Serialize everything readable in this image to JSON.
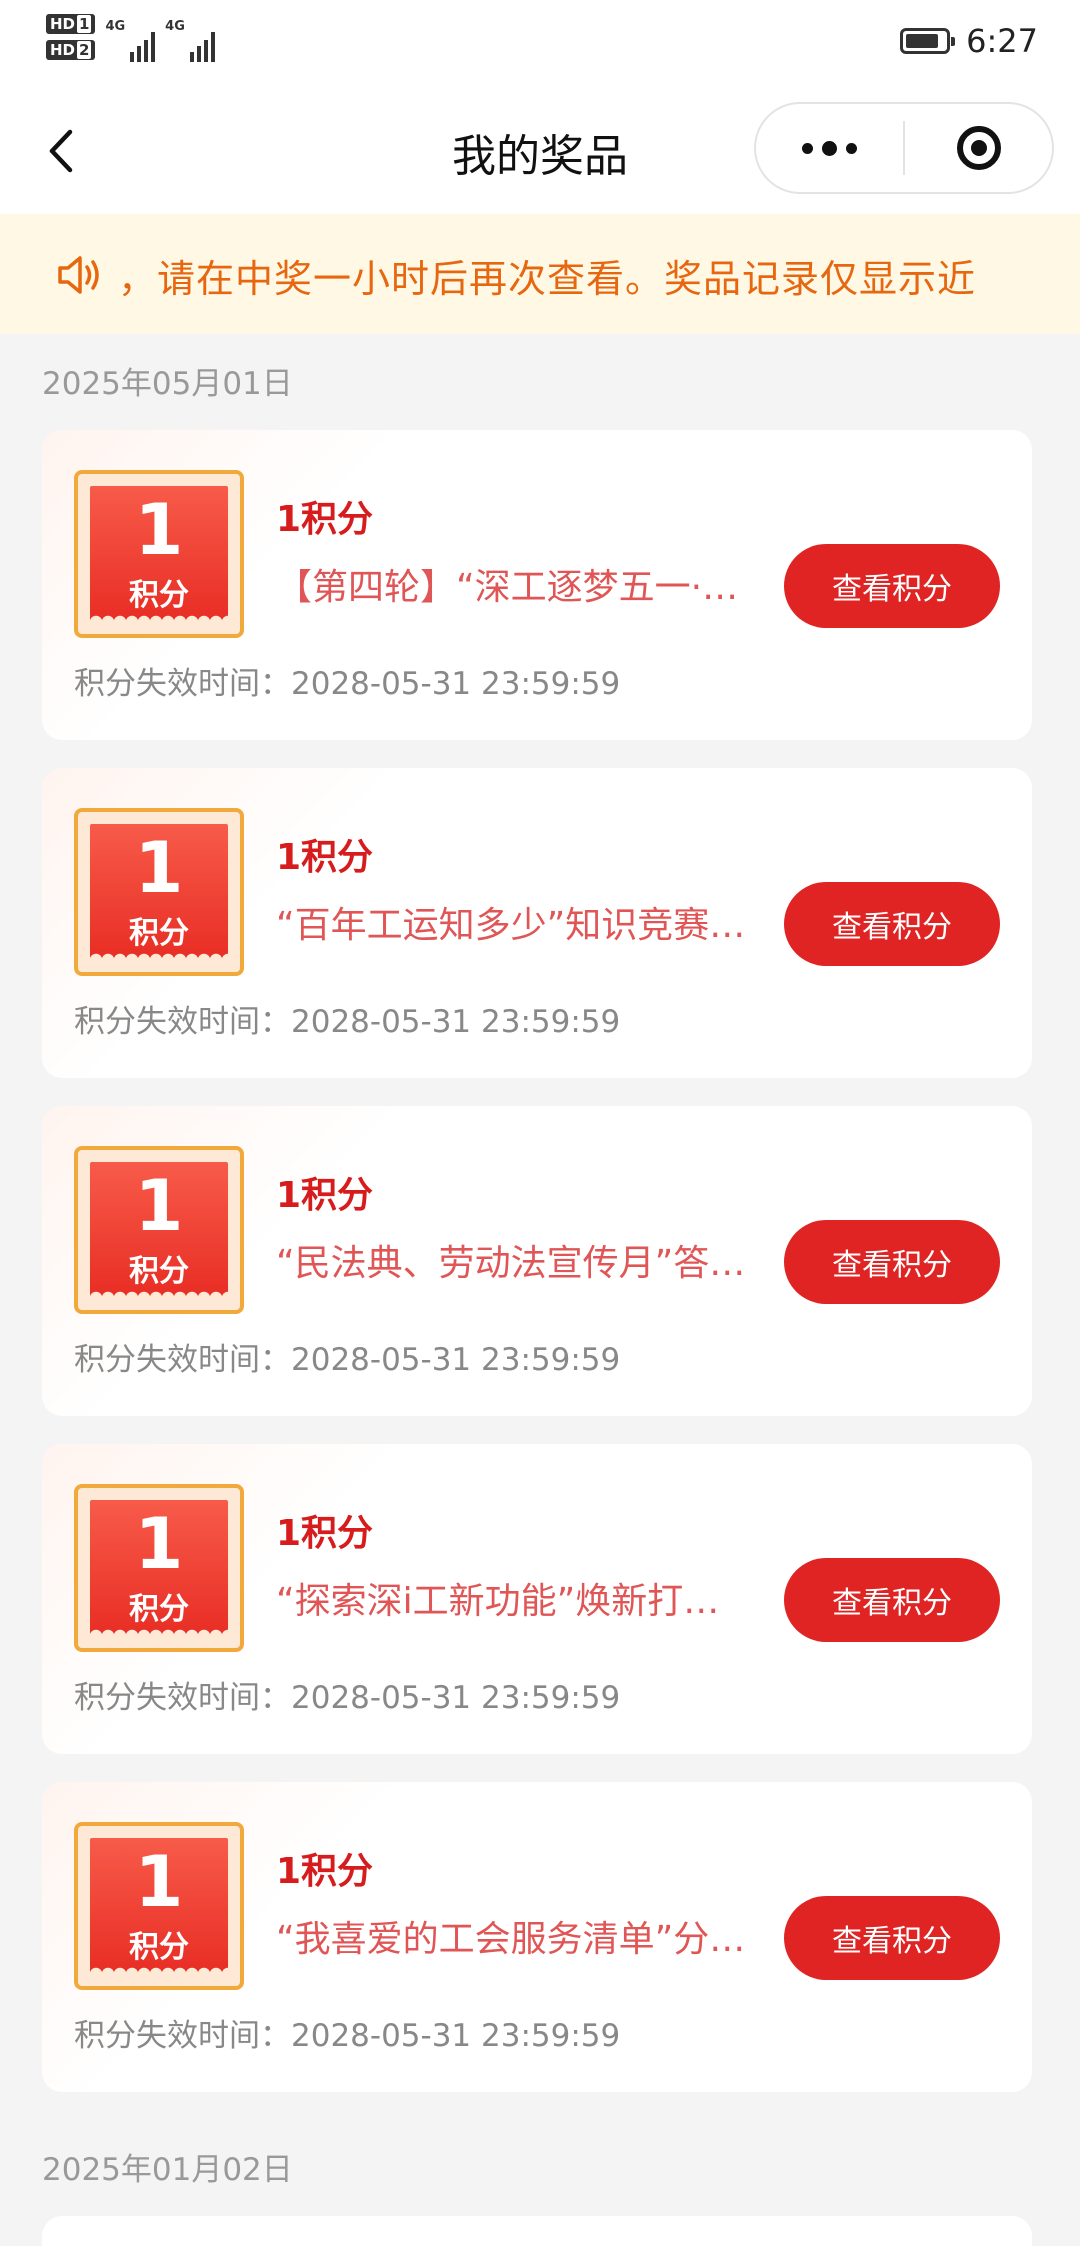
{
  "status_bar": {
    "sim1": "HD",
    "sim1_num": "1",
    "sim2": "HD",
    "sim2_num": "2",
    "net1": "4G",
    "net2": "4G",
    "time": "6:27",
    "battery_level": 0.85
  },
  "nav": {
    "title": "我的奖品"
  },
  "notice": {
    "text": "，请在中奖一小时后再次查看。奖品记录仅显示近"
  },
  "groups": [
    {
      "date": "2025年05月01日",
      "items": [
        {
          "badge_value": "1",
          "badge_unit": "积分",
          "name": "1积分",
          "desc": "【第四轮】“深工逐梦五一·…",
          "expire": "积分失效时间：2028-05-31 23:59:59",
          "button": "查看积分"
        },
        {
          "badge_value": "1",
          "badge_unit": "积分",
          "name": "1积分",
          "desc": "“百年工运知多少”知识竞赛…",
          "expire": "积分失效时间：2028-05-31 23:59:59",
          "button": "查看积分"
        },
        {
          "badge_value": "1",
          "badge_unit": "积分",
          "name": "1积分",
          "desc": "“民法典、劳动法宣传月”答…",
          "expire": "积分失效时间：2028-05-31 23:59:59",
          "button": "查看积分"
        },
        {
          "badge_value": "1",
          "badge_unit": "积分",
          "name": "1积分",
          "desc": "“探索深i工新功能”焕新打…",
          "expire": "积分失效时间：2028-05-31 23:59:59",
          "button": "查看积分"
        },
        {
          "badge_value": "1",
          "badge_unit": "积分",
          "name": "1积分",
          "desc": "“我喜爱的工会服务清单”分…",
          "expire": "积分失效时间：2028-05-31 23:59:59",
          "button": "查看积分"
        }
      ]
    },
    {
      "date": "2025年01月02日",
      "items": []
    }
  ]
}
